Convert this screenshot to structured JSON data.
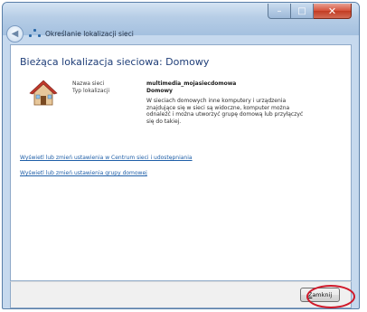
{
  "window": {
    "title": "Określanie lokalizacji sieci",
    "controls": {
      "minimize_glyph": "–",
      "maximize_glyph": "□",
      "close_glyph": "✕"
    }
  },
  "nav": {
    "back_glyph": "◀"
  },
  "content": {
    "heading": "Bieżąca lokalizacja sieciowa: Domowy",
    "network_name_label": "Nazwa sieci",
    "network_name_value": "multimedia_mojasiecdomowa",
    "location_type_label": "Typ lokalizacji",
    "location_type_value": "Domowy",
    "description": "W sieciach domowych inne komputery i urządzenia znajdujące się w sieci są widoczne, komputer można odnaleźć i można utworzyć grupę domową lub przyłączyć się do takiej.",
    "links": [
      "Wyświetl lub zmień ustawienia w Centrum sieci i udostępniania",
      "Wyświetl lub zmień ustawienia grupy domowej"
    ]
  },
  "footer": {
    "close_button_accesskey": "Z",
    "close_button_rest": "amknij"
  },
  "colors": {
    "heading": "#1f3e78",
    "link": "#1f5fa8",
    "highlight": "#d0192a"
  },
  "icons": [
    "back-arrow-icon",
    "network-icon",
    "house-icon",
    "minimize-icon",
    "maximize-icon",
    "close-icon"
  ]
}
